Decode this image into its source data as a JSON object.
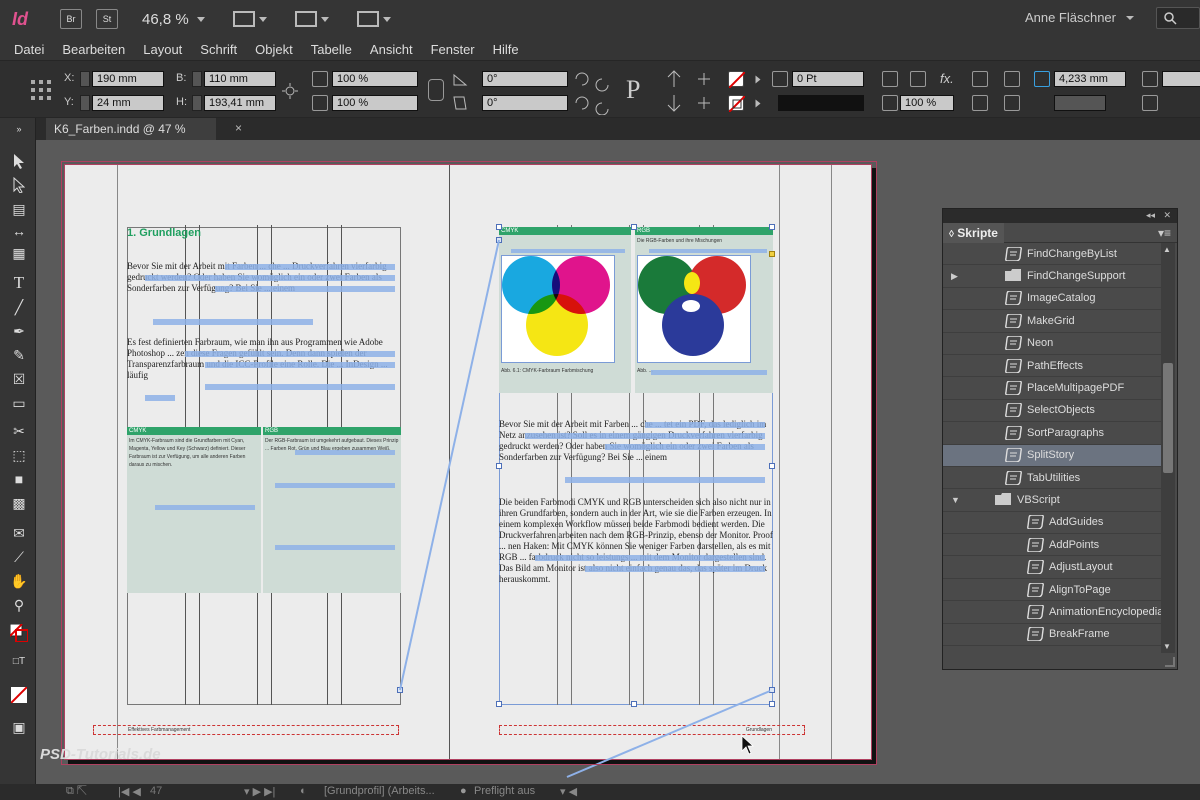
{
  "app": {
    "logo": "Id",
    "buttons": [
      "Br",
      "St"
    ],
    "zoom": "46,8 %",
    "user": "Anne Fläschner"
  },
  "menu": [
    "Datei",
    "Bearbeiten",
    "Layout",
    "Schrift",
    "Objekt",
    "Tabelle",
    "Ansicht",
    "Fenster",
    "Hilfe"
  ],
  "control": {
    "x_label": "X:",
    "x_value": "190 mm",
    "y_label": "Y:",
    "y_value": "24 mm",
    "b_label": "B:",
    "b_value": "110 mm",
    "h_label": "H:",
    "h_value": "193,41 mm",
    "scale_x": "100 %",
    "scale_y": "100 %",
    "angle": "0°",
    "shear": "0°",
    "stroke": "0 Pt",
    "opacity": "100 %",
    "size": "4,233 mm"
  },
  "document_tab": {
    "title": "K6_Farben.indd @ 47 %",
    "close": "×"
  },
  "page": {
    "left_heading": "1.  Grundlagen",
    "left_para1": "Bevor Sie mit der Arbeit mit Farben ... che ... Druckverfahren vierfarbig gedruckt werden? Oder haben Sie womöglich ein oder zwei Farben als Sonderfarben zur Verfügung? Bei Sie ... einem",
    "left_para2": "Es fest definierten Farbraum, wie man ihn aus Programmen wie Adobe Photoshop ... zen diese Fragen gefühlt sein. Denn dann spielen der Transparenzfarbraum und die ICC-Profile eine Rolle. Die ... InDesign ... läufig",
    "box_cmyk_head": "CMYK",
    "box_rgb_head": "RGB",
    "box_cmyk_text": "Im CMYK-Farbraum sind die Grundfarben mit Cyan, Magenta, Yellow und Key (Schwarz) definiert. Dieser Farbraum ist zur Verfügung, um alle anderen Farben daraus zu mischen.",
    "box_rgb_text": "Der RGB-Farbraum ist umgekehrt aufgebaut. Dieses Prinzip ... Farben Rot, Grün und Blau ergeben zusammen Weiß.",
    "right_para1": "Bevor Sie mit der Arbeit mit Farben ... che ... tet ein PDF, das lediglich im Netz anzusehen ist? Soll es in einem gängigen Druckverfahren vierfarbig gedruckt werden? Oder haben Sie womöglich ein oder zwei Farben als Sonderfarben zur Verfügung? Bei Sie ... einem",
    "right_para2": "Die beiden Farbmodi CMYK und RGB unterscheiden sich also nicht nur in ihren Grundfarben, sondern auch in der Art, wie sie die Farben erzeugen. In einem komplexen Workflow müssen beide Farbmodi bedient werden. Die Druckverfahren arbeiten nach dem RGB-Prinzip, ebenso der Monitor. Proof ... nen Haken: Mit CMYK können Sie weniger Farben darstellen, als es mit RGB ... farbdruck nicht so leistungs ... mit dem Monitor dargestellen sind. Das Bild am Monitor ist also nicht einfach genau das, das später im Druck herauskommt.",
    "cmyk_fig_head": "CMYK",
    "rgb_fig_head": "RGB",
    "cmyk_caption": "Abb. 6.1: CMYK-Farbraum Farbmischung",
    "rgb_caption_head": "Die RGB-Farben und ihre Mischungen",
    "rgb_caption": "Abb. ...",
    "footer_left": "Effektives Farbmanagement",
    "footer_right": "Grundlagen"
  },
  "scripts_panel": {
    "title": "Skripte",
    "items": [
      {
        "label": "FindChangeByList",
        "kind": "script"
      },
      {
        "label": "FindChangeSupport",
        "kind": "folder",
        "collapsed": true
      },
      {
        "label": "ImageCatalog",
        "kind": "script"
      },
      {
        "label": "MakeGrid",
        "kind": "script"
      },
      {
        "label": "Neon",
        "kind": "script"
      },
      {
        "label": "PathEffects",
        "kind": "script"
      },
      {
        "label": "PlaceMultipagePDF",
        "kind": "script"
      },
      {
        "label": "SelectObjects",
        "kind": "script"
      },
      {
        "label": "SortParagraphs",
        "kind": "script"
      },
      {
        "label": "SplitStory",
        "kind": "script",
        "selected": true
      },
      {
        "label": "TabUtilities",
        "kind": "script"
      },
      {
        "label": "VBScript",
        "kind": "folder",
        "expanded": true
      },
      {
        "label": "AddGuides",
        "kind": "script"
      },
      {
        "label": "AddPoints",
        "kind": "script"
      },
      {
        "label": "AdjustLayout",
        "kind": "script"
      },
      {
        "label": "AlignToPage",
        "kind": "script"
      },
      {
        "label": "AnimationEncyclopedia",
        "kind": "script"
      },
      {
        "label": "BreakFrame",
        "kind": "script"
      }
    ]
  },
  "status": {
    "page": "47",
    "profile": "[Grundprofil] (Arbeits...",
    "preflight": "Preflight aus"
  },
  "watermark": "PSD-Tutorials.de",
  "colors": {
    "accent_green": "#2fa36a",
    "highlight": "#8eb1e8",
    "cyan": "#19a8e0",
    "magenta": "#e0148c",
    "yellow": "#f5e614",
    "red": "#d42a2a",
    "green": "#1a7a3a",
    "blue": "#2b3a9a"
  }
}
